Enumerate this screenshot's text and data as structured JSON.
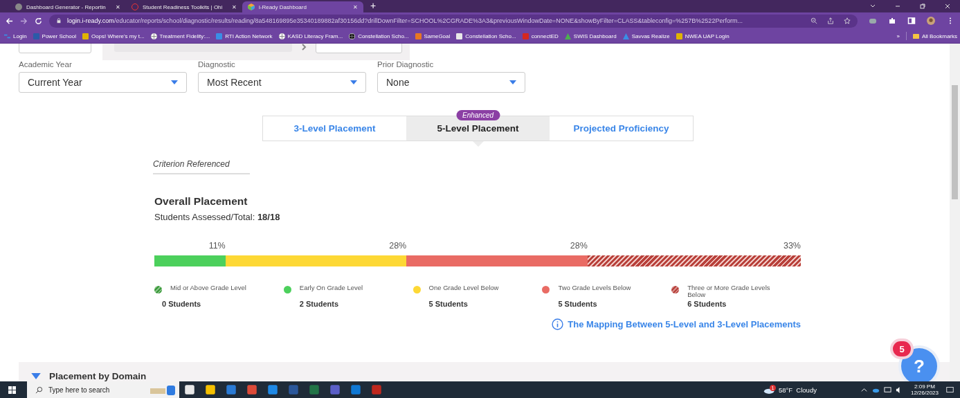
{
  "browser": {
    "tabs": [
      {
        "title": "Dashboard Generator - Reportin",
        "selected": false,
        "kind": "globe",
        "close": "✕"
      },
      {
        "title": "Student Readiness Toolkits | Ohi",
        "selected": false,
        "kind": "ring",
        "close": "✕"
      },
      {
        "title": "i-Ready Dashboard",
        "selected": true,
        "kind": "cube",
        "close": "✕"
      }
    ],
    "new_tab": "+",
    "url_host": "login.i-ready.com",
    "url_path": "/educator/reports/school/diagnostic/results/reading/8a548169895e35340189882af30156dd?drillDownFilter=SCHOOL%2CGRADE%3A3&previousWindowDate=NONE&showByFilter=CLASS&tableconfig=%257B%2522Perform...",
    "bookmarks": [
      {
        "label": "Login",
        "kind": "arrows",
        "color": "#3a8ee6"
      },
      {
        "label": "Power School",
        "kind": "tile",
        "color": "#2b5aa8"
      },
      {
        "label": "Oops! Where's my t...",
        "kind": "tile",
        "color": "#e0b400"
      },
      {
        "label": "Treatment Fidelity:...",
        "kind": "globe",
        "color": "#ffffff"
      },
      {
        "label": "RTI Action Network",
        "kind": "tile",
        "color": "#3a8ee6"
      },
      {
        "label": "KASD Literacy Fram...",
        "kind": "globe",
        "color": "#ffffff"
      },
      {
        "label": "Constellation Scho...",
        "kind": "globe",
        "color": "#111111"
      },
      {
        "label": "SameGoal",
        "kind": "tile",
        "color": "#e87722"
      },
      {
        "label": "Constellation Scho...",
        "kind": "tile",
        "color": "#e8e8e8"
      },
      {
        "label": "connectED",
        "kind": "tile",
        "color": "#d6281f"
      },
      {
        "label": "SWIS Dashboard",
        "kind": "triangle",
        "color": "#4caf50"
      },
      {
        "label": "Savvas Realize",
        "kind": "triangle",
        "color": "#3a8ee6"
      },
      {
        "label": "NWEA UAP Login",
        "kind": "tile",
        "color": "#e0b400"
      }
    ],
    "more": "»",
    "all_bookmarks": "All Bookmarks"
  },
  "filters": [
    {
      "label": "Academic Year",
      "value": "Current Year"
    },
    {
      "label": "Diagnostic",
      "value": "Most Recent"
    },
    {
      "label": "Prior Diagnostic",
      "value": "None"
    }
  ],
  "view_tabs": [
    {
      "label": "3-Level Placement",
      "selected": false
    },
    {
      "label": "5-Level Placement",
      "selected": true,
      "badge": "Enhanced"
    },
    {
      "label": "Projected Proficiency",
      "selected": false
    }
  ],
  "criterion": "Criterion Referenced",
  "overall": {
    "title": "Overall Placement",
    "assessed_label": "Students Assessed/Total:",
    "assessed_value": "18/18",
    "segments": [
      {
        "percent": "11%",
        "color": "#4cd05c",
        "kind": "solid"
      },
      {
        "percent": "28%",
        "color": "#fdd835",
        "kind": "solid"
      },
      {
        "percent": "28%",
        "color": "#e96b64",
        "kind": "solid"
      },
      {
        "percent": "33%",
        "color": "#b8403a",
        "kind": "striped"
      }
    ],
    "legend": [
      {
        "name": "Mid or Above Grade Level",
        "count": "0 Students",
        "color": "#3a9a3a",
        "kind": "striped"
      },
      {
        "name": "Early On Grade Level",
        "count": "2 Students",
        "color": "#4cd05c",
        "kind": "solid"
      },
      {
        "name": "One Grade Level Below",
        "count": "5 Students",
        "color": "#fdd835",
        "kind": "solid"
      },
      {
        "name": "Two Grade Levels Below",
        "count": "5 Students",
        "color": "#e96b64",
        "kind": "solid"
      },
      {
        "name": "Three or More Grade Levels Below",
        "count": "6 Students",
        "color": "#b8403a",
        "kind": "striped"
      }
    ],
    "mapping_link": "The Mapping Between 5-Level and 3-Level Placements"
  },
  "domain_section": {
    "title": "Placement by Domain",
    "expanded": true
  },
  "help": {
    "badge": "5",
    "label": "?"
  },
  "taskbar": {
    "search_placeholder": "Type here to search",
    "weather": "58°F  Cloudy",
    "weather_badge": "1",
    "time": "2:09 PM",
    "date": "12/26/2023"
  }
}
